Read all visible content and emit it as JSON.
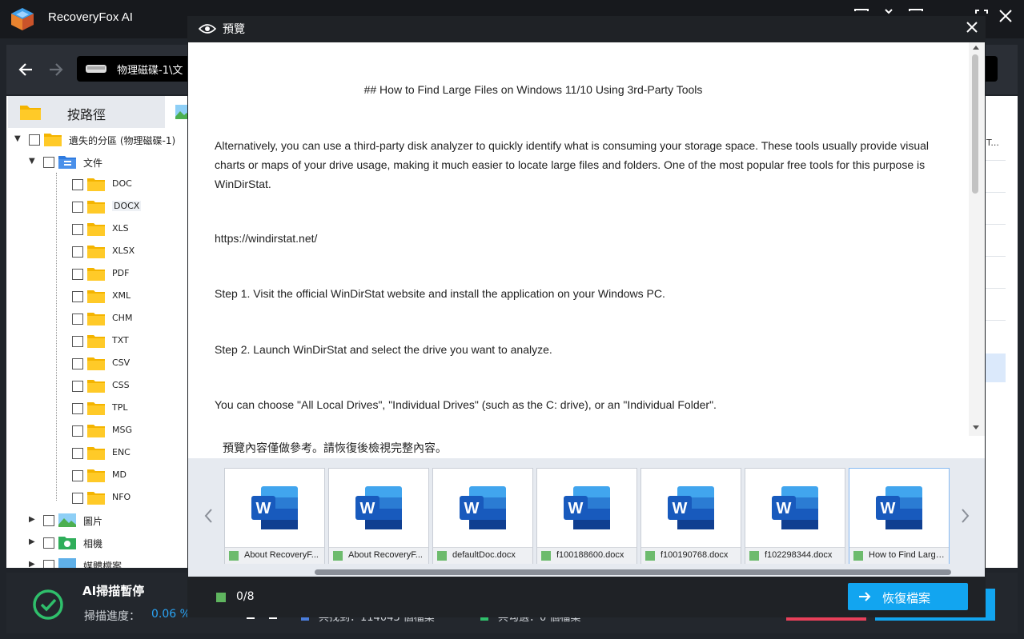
{
  "app": {
    "title": "RecoveryFox AI",
    "path": "物理磁碟-1\\文",
    "window_controls": [
      "minimize-icon",
      "restore-icon",
      "maximize-icon",
      "close-icon"
    ]
  },
  "left_panel": {
    "tab_label": "按路徑",
    "tree": [
      {
        "label": "遺失的分區 (物理磁碟-1)",
        "level": 0,
        "expanded": true
      },
      {
        "label": "文件",
        "level": 1,
        "expanded": true
      },
      {
        "label": "DOC",
        "level": 2
      },
      {
        "label": "DOCX",
        "level": 2
      },
      {
        "label": "XLS",
        "level": 2
      },
      {
        "label": "XLSX",
        "level": 2
      },
      {
        "label": "PDF",
        "level": 2
      },
      {
        "label": "XML",
        "level": 2
      },
      {
        "label": "CHM",
        "level": 2
      },
      {
        "label": "TXT",
        "level": 2
      },
      {
        "label": "CSV",
        "level": 2
      },
      {
        "label": "CSS",
        "level": 2
      },
      {
        "label": "TPL",
        "level": 2
      },
      {
        "label": "MSG",
        "level": 2
      },
      {
        "label": "ENC",
        "level": 2
      },
      {
        "label": "MD",
        "level": 2
      },
      {
        "label": "NFO",
        "level": 2
      },
      {
        "label": "圖片",
        "level": 1,
        "expanded": false
      },
      {
        "label": "相機",
        "level": 1,
        "expanded": false
      },
      {
        "label": "媒體檔案",
        "level": 1,
        "expanded": false
      }
    ]
  },
  "right_partial": {
    "header_fragment": "T..."
  },
  "status": {
    "title": "AI掃描暫停",
    "progress_label": "掃描進度：",
    "progress_value": "0.06 %",
    "found_label": "共找到：114043 個檔案",
    "selected_label": "共勾選：0 個檔案"
  },
  "preview": {
    "title": "預覽",
    "doc": {
      "heading": "## How to Find Large Files on Windows 11/10 Using 3rd-Party Tools",
      "paragraphs": [
        "Alternatively, you can use a third-party disk analyzer to quickly identify what is consuming your storage space. These tools usually provide visual charts or maps of your drive usage, making it much easier to locate large files and folders. One of the most popular free tools for this purpose is WinDirStat.",
        "https://windirstat.net/",
        "Step 1. Visit the official WinDirStat website and install the application on your Windows PC.",
        "Step 2. Launch WinDirStat and select the drive you want to analyze.",
        "You can choose \"All Local Drives\", \"Individual Drives\" (such as the C: drive), or an \"Individual Folder\"."
      ]
    },
    "note": "預覽內容僅做參考。請恢復後檢視完整內容。",
    "thumbnails": [
      {
        "name": "About RecoveryF...",
        "selected": false
      },
      {
        "name": "About RecoveryF...",
        "selected": false
      },
      {
        "name": "defaultDoc.docx",
        "selected": false
      },
      {
        "name": "f100188600.docx",
        "selected": false
      },
      {
        "name": "f100190768.docx",
        "selected": false
      },
      {
        "name": "f102298344.docx",
        "selected": false
      },
      {
        "name": "How to Find Large...",
        "selected": true
      }
    ],
    "selection_count": "0/8",
    "recover_button": "恢復檔案"
  },
  "colors": {
    "accent": "#12a5f0",
    "progress": "#2aa4f4",
    "word_blue": "#185abd",
    "selected_green": "#5fb55f"
  }
}
